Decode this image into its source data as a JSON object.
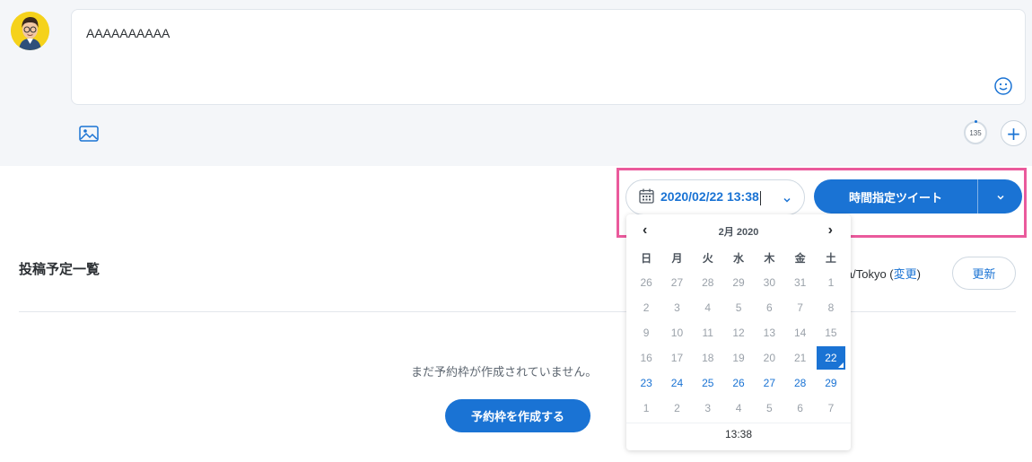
{
  "composer": {
    "text": "AAAAAAAAAA",
    "char_count": "135"
  },
  "scheduler": {
    "datetime": "2020/02/22 13:38",
    "schedule_label": "時間指定ツイート"
  },
  "calendar": {
    "month_label": "2月 2020",
    "prev": "‹",
    "next": "›",
    "weekdays": [
      "日",
      "月",
      "火",
      "水",
      "木",
      "金",
      "土"
    ],
    "weeks": [
      [
        "26",
        "27",
        "28",
        "29",
        "30",
        "31",
        "1"
      ],
      [
        "2",
        "3",
        "4",
        "5",
        "6",
        "7",
        "8"
      ],
      [
        "9",
        "10",
        "11",
        "12",
        "13",
        "14",
        "15"
      ],
      [
        "16",
        "17",
        "18",
        "19",
        "20",
        "21",
        "22"
      ],
      [
        "23",
        "24",
        "25",
        "26",
        "27",
        "28",
        "29"
      ],
      [
        "1",
        "2",
        "3",
        "4",
        "5",
        "6",
        "7"
      ]
    ],
    "selected": "22",
    "time": "13:38"
  },
  "schedule_list": {
    "title": "投稿予定一覧",
    "timezone_text": "ia/Tokyo (",
    "timezone_change": "変更",
    "timezone_close": ")",
    "refresh_label": "更新",
    "empty_message": "まだ予約枠が作成されていません。",
    "create_label": "予約枠を作成する"
  },
  "colors": {
    "accent": "#1a73d4",
    "highlight": "#ea5a9c",
    "panel_bg": "#f4f6f9"
  }
}
